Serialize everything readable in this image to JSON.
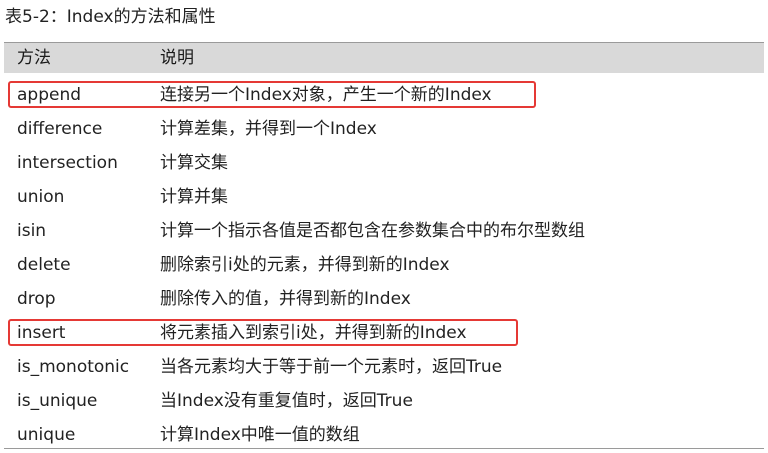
{
  "caption": "表5-2：Index的方法和属性",
  "table": {
    "headers": [
      "方法",
      "说明"
    ],
    "rows": [
      {
        "method": "append",
        "desc": "连接另一个Index对象，产生一个新的Index",
        "highlighted": true
      },
      {
        "method": "difference",
        "desc": "计算差集，并得到一个Index",
        "highlighted": false
      },
      {
        "method": "intersection",
        "desc": "计算交集",
        "highlighted": false
      },
      {
        "method": "union",
        "desc": "计算并集",
        "highlighted": false
      },
      {
        "method": "isin",
        "desc": "计算一个指示各值是否都包含在参数集合中的布尔型数组",
        "highlighted": false
      },
      {
        "method": "delete",
        "desc": "删除索引i处的元素，并得到新的Index",
        "highlighted": false
      },
      {
        "method": "drop",
        "desc": "删除传入的值，并得到新的Index",
        "highlighted": false
      },
      {
        "method": "insert",
        "desc": "将元素插入到索引i处，并得到新的Index",
        "highlighted": true
      },
      {
        "method": "is_monotonic",
        "desc": "当各元素均大于等于前一个元素时，返回True",
        "highlighted": false
      },
      {
        "method": "is_unique",
        "desc": "当Index没有重复值时，返回True",
        "highlighted": false
      },
      {
        "method": "unique",
        "desc": "计算Index中唯一值的数组",
        "highlighted": false
      }
    ]
  },
  "colors": {
    "header_bg": "#d9d9d9",
    "highlight_border": "#e53935"
  }
}
